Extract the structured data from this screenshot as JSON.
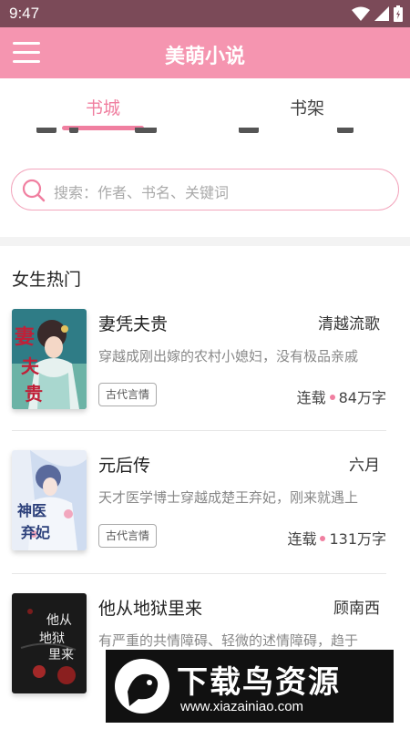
{
  "status_bar": {
    "time": "9:47"
  },
  "app_bar": {
    "title": "美萌小说"
  },
  "tabs": [
    {
      "label": "书城",
      "active": true
    },
    {
      "label": "书架",
      "active": false
    }
  ],
  "search": {
    "placeholder": "搜索：作者、书名、关键词"
  },
  "section": {
    "title": "女生热门"
  },
  "books": [
    {
      "title": "妻凭夫贵",
      "author": "清越流歌",
      "description": "穿越成刚出嫁的农村小媳妇，没有极品亲戚",
      "tag": "古代言情",
      "status": "连载",
      "words": "84万字"
    },
    {
      "title": "元后传",
      "author": "六月",
      "description": "天才医学博士穿越成楚王弃妃，刚来就遇上",
      "tag": "古代言情",
      "status": "连载",
      "words": "131万字"
    },
    {
      "title": "他从地狱里来",
      "author": "顾南西",
      "description": "有严重的共情障碍、轻微的述情障碍，趋于",
      "tag": "",
      "status": "",
      "words": ""
    }
  ],
  "watermark": {
    "title": "下载鸟资源",
    "url": "www.xiazainiao.com"
  },
  "colors": {
    "accent": "#f07fa0",
    "app_bar": "#f595b0",
    "status_bar": "#7b4a58"
  }
}
